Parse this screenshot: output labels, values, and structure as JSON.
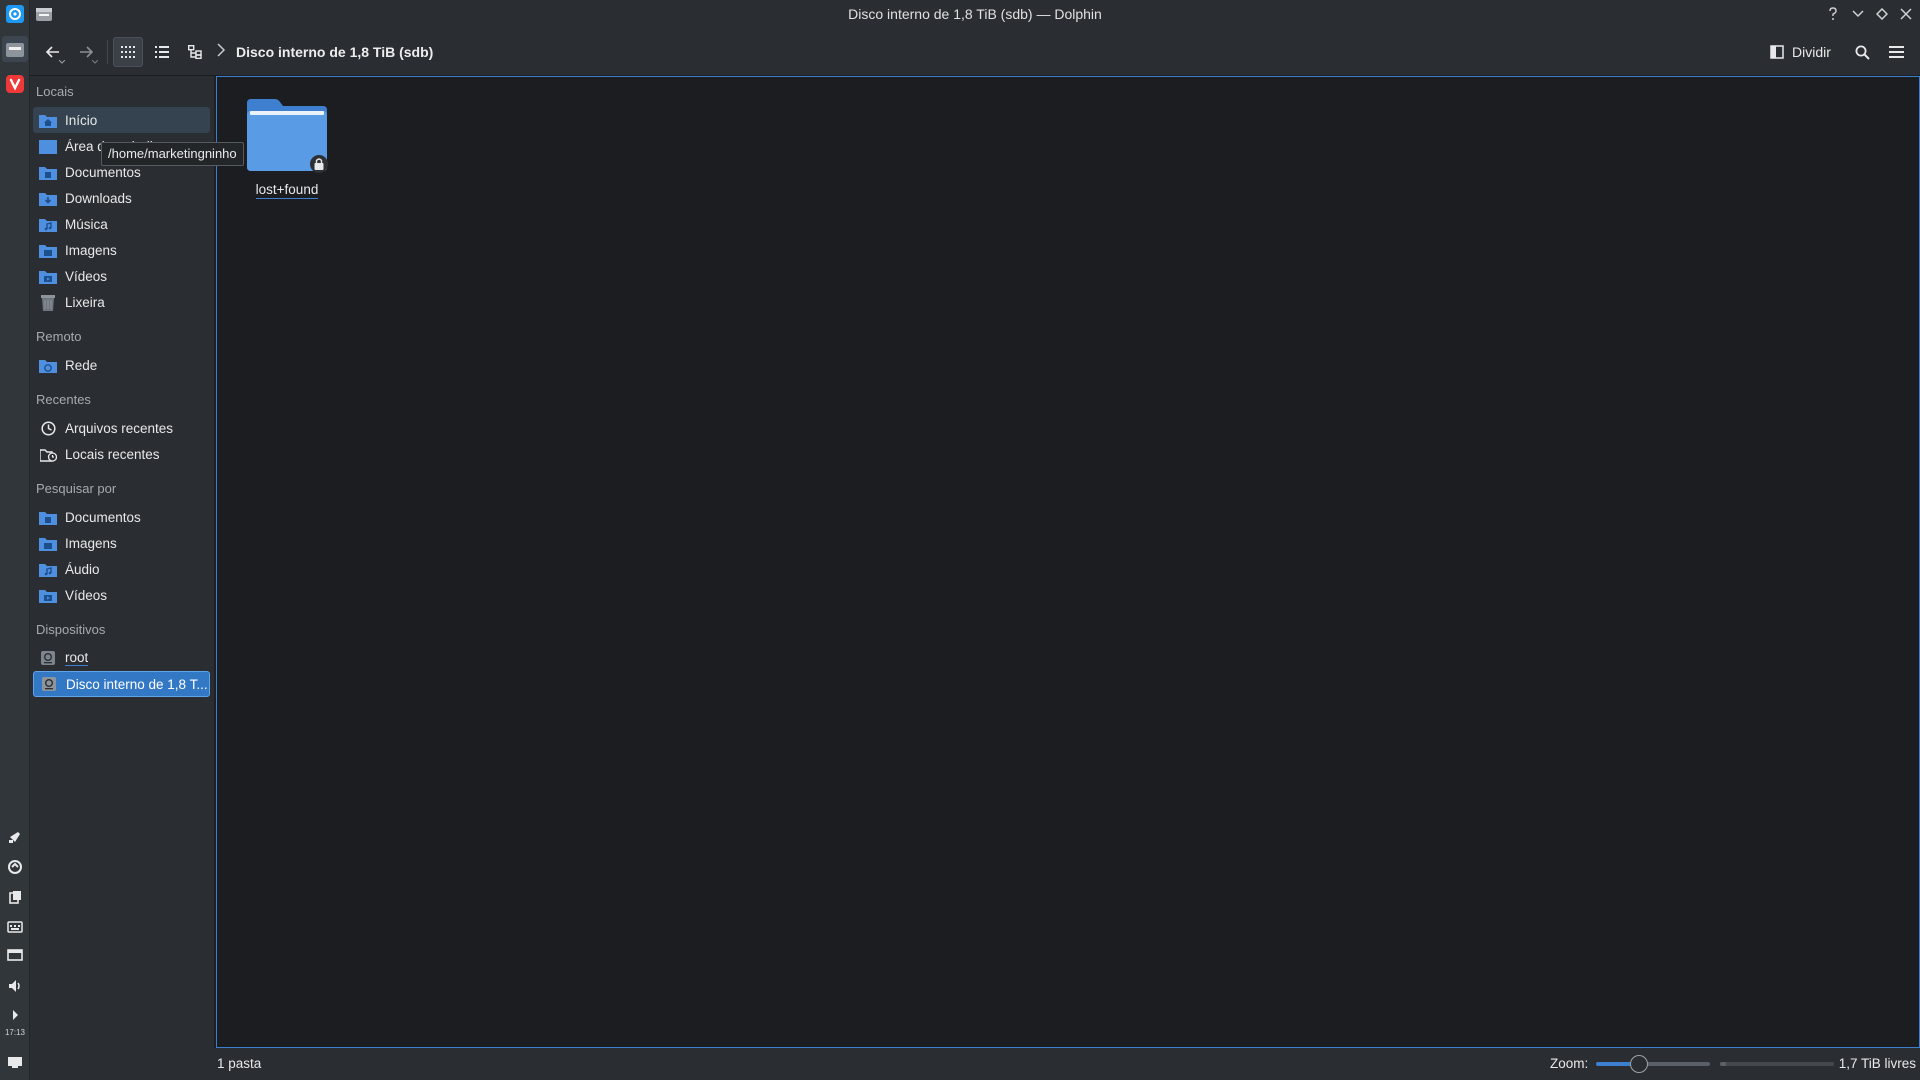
{
  "window": {
    "title": "Disco interno de 1,8 TiB (sdb) — Dolphin"
  },
  "toolbar": {
    "breadcrumb": "Disco interno de 1,8 TiB (sdb)",
    "split_label": "Dividir"
  },
  "sidebar": {
    "sections": {
      "locais": "Locais",
      "remoto": "Remoto",
      "recentes": "Recentes",
      "pesquisar": "Pesquisar por",
      "dispositivos": "Dispositivos"
    },
    "locais": [
      "Início",
      "Área de trabalho",
      "Documentos",
      "Downloads",
      "Música",
      "Imagens",
      "Vídeos",
      "Lixeira"
    ],
    "remoto": [
      "Rede"
    ],
    "recentes": [
      "Arquivos recentes",
      "Locais recentes"
    ],
    "pesquisar": [
      "Documentos",
      "Imagens",
      "Áudio",
      "Vídeos"
    ],
    "dispositivos": [
      "root",
      "Disco interno de 1,8 T..."
    ]
  },
  "tooltip": "/home/marketingninho",
  "files": [
    {
      "name": "lost+found",
      "icon": "folder-locked-icon"
    }
  ],
  "status": {
    "summary": "1 pasta",
    "zoom_label": "Zoom:",
    "zoom_level": 0.38,
    "free_space": "1,7 TiB livres",
    "used_fraction": 0.05
  },
  "taskbar": {
    "clock": "17:13"
  },
  "colors": {
    "accent": "#3c7fcf",
    "folder": "#4f8fdf"
  }
}
